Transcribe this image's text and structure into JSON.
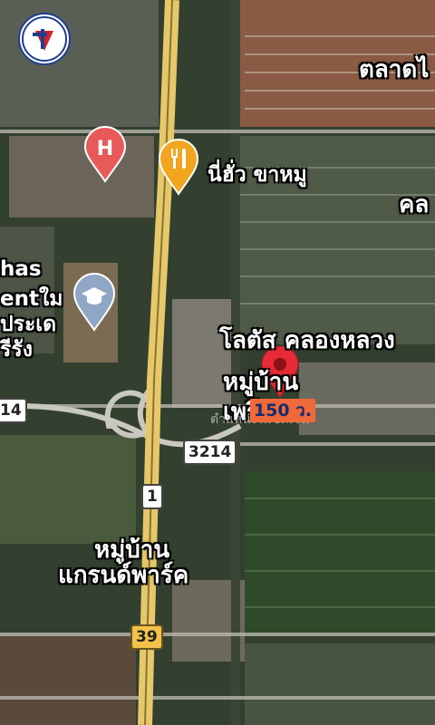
{
  "map": {
    "logo": {
      "name": "company-logo"
    },
    "labels": {
      "talat": "ตลาดไ",
      "nihua": "นี่ฮั่ว ขาหมู",
      "khlo": "คล",
      "lotus": "โลตัส คลองหลวง",
      "village1_line1": "หมู่บ้าน",
      "village1_line2": "เพรีย  อง",
      "grand_line1": "หมู่บ้าน",
      "grand_line2": "แกรนด์พาร์ค",
      "school_line1": "has",
      "school_line2": "entใม",
      "school_line3": "ประเด",
      "school_line4": "รีรัง",
      "faded_text": "ตำแหน่งไม่ชัดเจน"
    },
    "shields": {
      "route_3214": "3214",
      "route_14": "14",
      "route_1": "1",
      "route_39": "39"
    },
    "price_badge": "150 ว.",
    "icons": {
      "hospital": "hospital-marker",
      "restaurant": "restaurant-marker",
      "school": "school-marker",
      "location": "location-pin"
    },
    "colors": {
      "highway": "#e6c86a",
      "pin": "#e62b36",
      "price_badge": "#f0693b",
      "hospital": "#e85a5a",
      "restaurant": "#f2a51f",
      "school": "#8fa7c4"
    }
  }
}
